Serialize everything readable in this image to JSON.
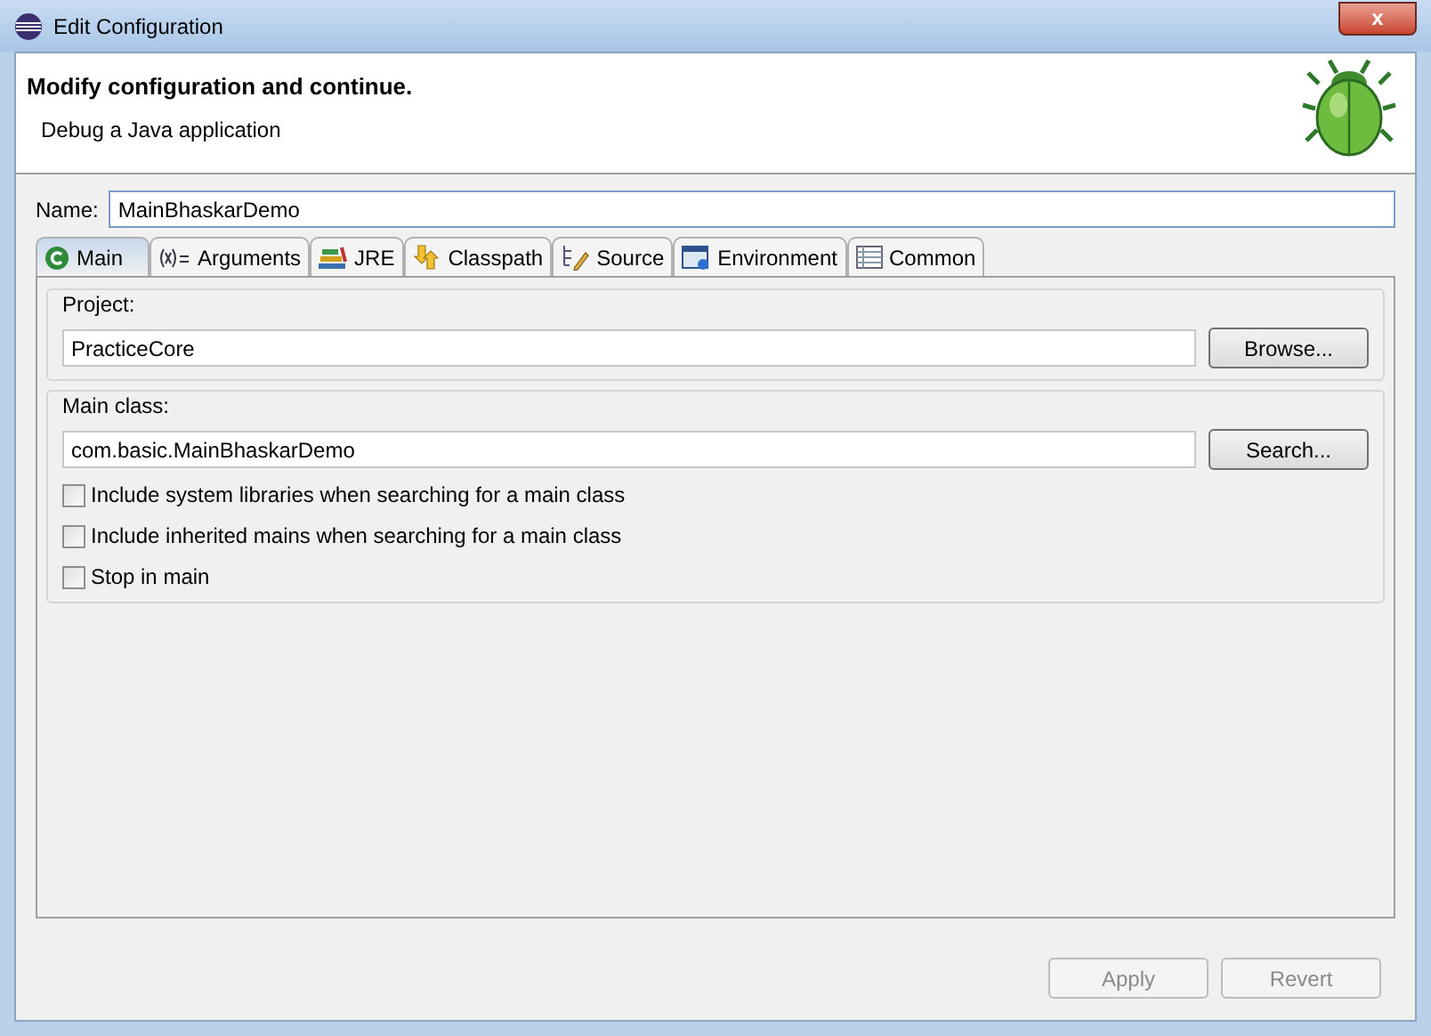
{
  "window": {
    "title": "Edit Configuration",
    "close": "x"
  },
  "header": {
    "title": "Modify configuration and continue.",
    "subtitle": "Debug a Java application"
  },
  "name_field": {
    "label": "Name:",
    "value": "MainBhaskarDemo"
  },
  "tabs": [
    {
      "label": "Main",
      "kind": "main",
      "selected": true
    },
    {
      "label": "Arguments",
      "kind": "arguments",
      "selected": false
    },
    {
      "label": "JRE",
      "kind": "jre",
      "selected": false
    },
    {
      "label": "Classpath",
      "kind": "classpath",
      "selected": false
    },
    {
      "label": "Source",
      "kind": "source",
      "selected": false
    },
    {
      "label": "Environment",
      "kind": "environment",
      "selected": false
    },
    {
      "label": "Common",
      "kind": "common",
      "selected": false
    }
  ],
  "project": {
    "label": "Project:",
    "value": "PracticeCore",
    "button": "Browse..."
  },
  "main_class": {
    "label": "Main class:",
    "value": "com.basic.MainBhaskarDemo",
    "button": "Search..."
  },
  "options": [
    {
      "label": "Include system libraries when searching for a main class",
      "checked": false
    },
    {
      "label": "Include inherited mains when searching for a main class",
      "checked": false
    },
    {
      "label": "Stop in main",
      "checked": false
    }
  ],
  "buttons": [
    {
      "label": "Apply",
      "disabled": true
    },
    {
      "label": "Revert",
      "disabled": true
    }
  ]
}
